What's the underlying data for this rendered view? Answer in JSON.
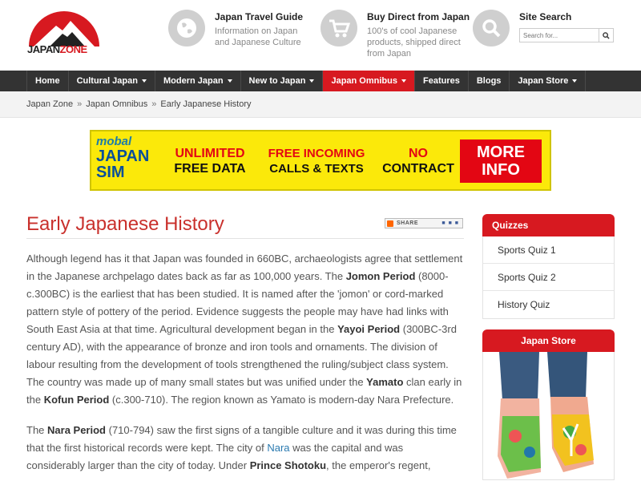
{
  "logo": {
    "text_a": "JAPAN",
    "text_b": "ZONE"
  },
  "header": {
    "travel": {
      "title": "Japan Travel Guide",
      "desc": "Information on Japan and Japanese Culture",
      "icon": "globe-icon"
    },
    "buy": {
      "title": "Buy Direct from Japan",
      "desc": "100's of cool Japanese products, shipped direct from Japan",
      "icon": "cart-icon"
    },
    "search": {
      "title": "Site Search",
      "placeholder": "Search for...",
      "icon": "search-icon"
    }
  },
  "nav": {
    "items": [
      {
        "label": "Home"
      },
      {
        "label": "Cultural Japan"
      },
      {
        "label": "Modern Japan"
      },
      {
        "label": "New to Japan"
      },
      {
        "label": "Japan Omnibus"
      },
      {
        "label": "Features"
      },
      {
        "label": "Blogs"
      },
      {
        "label": "Japan Store"
      }
    ]
  },
  "breadcrumb": {
    "items": [
      "Japan Zone",
      "Japan Omnibus",
      "Early Japanese History"
    ],
    "separator": "»"
  },
  "banner": {
    "brand": "mobal",
    "brand_line2": "JAPAN",
    "brand_line3": "SIM",
    "seg1_l1": "UNLIMITED",
    "seg1_l2": "FREE DATA",
    "seg2_l1": "FREE INCOMING",
    "seg2_l2": "CALLS & TEXTS",
    "seg3_l1": "NO",
    "seg3_l2": "CONTRACT",
    "cta_l1": "MORE",
    "cta_l2": "INFO"
  },
  "main": {
    "title": "Early Japanese History",
    "share_label": "SHARE",
    "p1": [
      {
        "t": "Although legend has it that Japan was founded in 660BC, archaeologists agree that settlement in the Japanese archpelago dates back as far as 100,000 years. The "
      },
      {
        "b": "Jomon Period"
      },
      {
        "t": " (8000-c.300BC) is the earliest that has been studied. It is named after the 'jomon' or cord-marked pattern style of pottery of the period. Evidence suggests the people may have had links with South East Asia at that time. Agricultural development began in the "
      },
      {
        "b": "Yayoi Period"
      },
      {
        "t": " (300BC-3rd century AD), with the appearance of bronze and iron tools and ornaments. The division of labour resulting from the development of tools strengthened the ruling/subject class system. The country was made up of many small states but was unified under the "
      },
      {
        "b": "Yamato"
      },
      {
        "t": " clan early in the "
      },
      {
        "b": "Kofun Period"
      },
      {
        "t": " (c.300-710). The region known as Yamato is modern-day Nara Prefecture."
      }
    ],
    "p2": [
      {
        "t": "The "
      },
      {
        "b": "Nara Period"
      },
      {
        "t": " (710-794) saw the first signs of a tangible culture and it was during this time that the first historical records were kept. The city of "
      },
      {
        "a": "Nara"
      },
      {
        "t": " was the capital and was considerably larger than the city of today. Under "
      },
      {
        "b": "Prince Shotoku"
      },
      {
        "t": ", the emperor's regent,"
      }
    ]
  },
  "sidebar": {
    "quizzes_title": "Quizzes",
    "quizzes": [
      "Sports Quiz 1",
      "Sports Quiz 2",
      "History Quiz"
    ],
    "store_title": "Japan Store"
  },
  "colors": {
    "accent": "#d71920",
    "nav_bg": "#333333",
    "banner_bg": "#fbe90a",
    "link": "#2a7ab0"
  }
}
